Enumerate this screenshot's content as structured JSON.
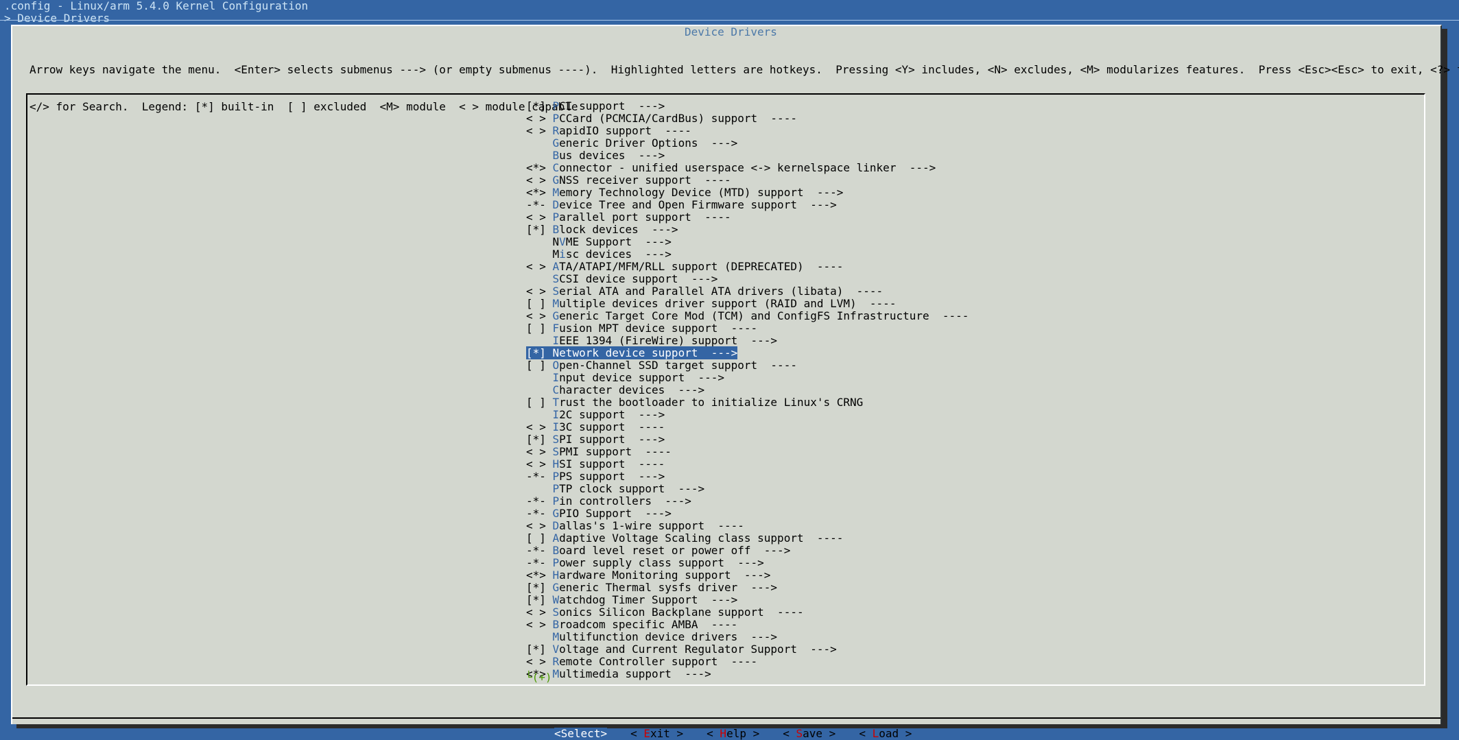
{
  "window": {
    "title": ".config - Linux/arm 5.4.0 Kernel Configuration",
    "breadcrumb": "> Device Drivers"
  },
  "dialog": {
    "title": "Device Drivers",
    "help_line1": "Arrow keys navigate the menu.  <Enter> selects submenus ---> (or empty submenus ----).  Highlighted letters are hotkeys.  Pressing <Y> includes, <N> excludes, <M> modularizes features.  Press <Esc><Esc> to exit, <?> for Help,",
    "help_line2": "</> for Search.  Legend: [*] built-in  [ ] excluded  <M> module  < > module capable"
  },
  "menu": {
    "selected_index": 20,
    "items": [
      {
        "prefix": "[*] ",
        "hotkey": "P",
        "rest": "CI support  --->"
      },
      {
        "prefix": "< > ",
        "hotkey": "P",
        "rest": "CCard (PCMCIA/CardBus) support  ----"
      },
      {
        "prefix": "< > ",
        "hotkey": "R",
        "rest": "apidIO support  ----"
      },
      {
        "prefix": "    ",
        "hotkey": "G",
        "rest": "eneric Driver Options  --->"
      },
      {
        "prefix": "    ",
        "hotkey": "B",
        "rest": "us devices  --->"
      },
      {
        "prefix": "<*> ",
        "hotkey": "C",
        "rest": "onnector - unified userspace <-> kernelspace linker  --->"
      },
      {
        "prefix": "< > ",
        "hotkey": "G",
        "rest": "NSS receiver support  ----"
      },
      {
        "prefix": "<*> ",
        "hotkey": "M",
        "rest": "emory Technology Device (MTD) support  --->"
      },
      {
        "prefix": "-*- ",
        "hotkey": "D",
        "rest": "evice Tree and Open Firmware support  --->"
      },
      {
        "prefix": "< > ",
        "hotkey": "P",
        "rest": "arallel port support  ----"
      },
      {
        "prefix": "[*] ",
        "hotkey": "B",
        "rest": "lock devices  --->"
      },
      {
        "prefix": "    N",
        "hotkey": "V",
        "rest": "ME Support  --->"
      },
      {
        "prefix": "    M",
        "hotkey": "i",
        "rest": "sc devices  --->"
      },
      {
        "prefix": "< > ",
        "hotkey": "A",
        "rest": "TA/ATAPI/MFM/RLL support (DEPRECATED)  ----"
      },
      {
        "prefix": "    ",
        "hotkey": "S",
        "rest": "CSI device support  --->"
      },
      {
        "prefix": "< > ",
        "hotkey": "S",
        "rest": "erial ATA and Parallel ATA drivers (libata)  ----"
      },
      {
        "prefix": "[ ] ",
        "hotkey": "M",
        "rest": "ultiple devices driver support (RAID and LVM)  ----"
      },
      {
        "prefix": "< > ",
        "hotkey": "G",
        "rest": "eneric Target Core Mod (TCM) and ConfigFS Infrastructure  ----"
      },
      {
        "prefix": "[ ] ",
        "hotkey": "F",
        "rest": "usion MPT device support  ----"
      },
      {
        "prefix": "    ",
        "hotkey": "I",
        "rest": "EEE 1394 (FireWire) support  --->"
      },
      {
        "prefix": "[*] ",
        "hotkey": "N",
        "rest": "etwork device support  --->"
      },
      {
        "prefix": "[ ] ",
        "hotkey": "O",
        "rest": "pen-Channel SSD target support  ----"
      },
      {
        "prefix": "    ",
        "hotkey": "I",
        "rest": "nput device support  --->"
      },
      {
        "prefix": "    ",
        "hotkey": "C",
        "rest": "haracter devices  --->"
      },
      {
        "prefix": "[ ] ",
        "hotkey": "T",
        "rest": "rust the bootloader to initialize Linux's CRNG"
      },
      {
        "prefix": "    ",
        "hotkey": "I",
        "rest": "2C support  --->"
      },
      {
        "prefix": "< > ",
        "hotkey": "I",
        "rest": "3C support  ----"
      },
      {
        "prefix": "[*] ",
        "hotkey": "S",
        "rest": "PI support  --->"
      },
      {
        "prefix": "< > ",
        "hotkey": "S",
        "rest": "PMI support  ----"
      },
      {
        "prefix": "< > ",
        "hotkey": "H",
        "rest": "SI support  ----"
      },
      {
        "prefix": "-*- ",
        "hotkey": "P",
        "rest": "PS support  --->"
      },
      {
        "prefix": "    ",
        "hotkey": "P",
        "rest": "TP clock support  --->"
      },
      {
        "prefix": "-*- ",
        "hotkey": "P",
        "rest": "in controllers  --->"
      },
      {
        "prefix": "-*- ",
        "hotkey": "G",
        "rest": "PIO Support  --->"
      },
      {
        "prefix": "< > ",
        "hotkey": "D",
        "rest": "allas's 1-wire support  ----"
      },
      {
        "prefix": "[ ] ",
        "hotkey": "A",
        "rest": "daptive Voltage Scaling class support  ----"
      },
      {
        "prefix": "-*- ",
        "hotkey": "B",
        "rest": "oard level reset or power off  --->"
      },
      {
        "prefix": "-*- ",
        "hotkey": "P",
        "rest": "ower supply class support  --->"
      },
      {
        "prefix": "<*> ",
        "hotkey": "H",
        "rest": "ardware Monitoring support  --->"
      },
      {
        "prefix": "[*] ",
        "hotkey": "G",
        "rest": "eneric Thermal sysfs driver  --->"
      },
      {
        "prefix": "[*] ",
        "hotkey": "W",
        "rest": "atchdog Timer Support  --->"
      },
      {
        "prefix": "< > ",
        "hotkey": "S",
        "rest": "onics Silicon Backplane support  ----"
      },
      {
        "prefix": "< > ",
        "hotkey": "B",
        "rest": "roadcom specific AMBA  ----"
      },
      {
        "prefix": "    ",
        "hotkey": "M",
        "rest": "ultifunction device drivers  --->"
      },
      {
        "prefix": "[*] ",
        "hotkey": "V",
        "rest": "oltage and Current Regulator Support  --->"
      },
      {
        "prefix": "< > ",
        "hotkey": "R",
        "rest": "emote Controller support  ----"
      },
      {
        "prefix": "<*> ",
        "hotkey": "M",
        "rest": "ultimedia support  --->"
      }
    ],
    "more_indicator": "└(+)"
  },
  "buttons": [
    {
      "pre": "<",
      "hotkey": "S",
      "rest": "elect>",
      "active": true
    },
    {
      "pre": "< ",
      "hotkey": "E",
      "rest": "xit >",
      "active": false
    },
    {
      "pre": "< ",
      "hotkey": "H",
      "rest": "elp >",
      "active": false
    },
    {
      "pre": "< ",
      "hotkey": "S",
      "rest": "ave >",
      "active": false
    },
    {
      "pre": "< ",
      "hotkey": "L",
      "rest": "oad >",
      "active": false
    }
  ],
  "colors": {
    "background": "#3465a4",
    "dialog": "#d3d7cf",
    "hotkey": "#3465a4",
    "button_hotkey": "#cc0000",
    "selection": "#3465a4"
  }
}
